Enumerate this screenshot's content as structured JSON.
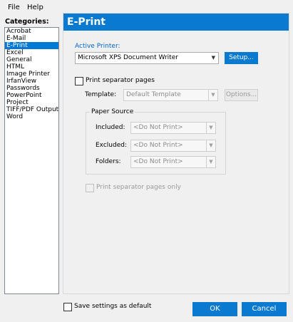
{
  "menu": {
    "file": "File",
    "help": "Help"
  },
  "categories": {
    "label": "Categories:",
    "items": [
      "Acrobat",
      "E-Mail",
      "E-Print",
      "Excel",
      "General",
      "HTML",
      "Image Printer",
      "IrfanView",
      "Passwords",
      "PowerPoint",
      "Project",
      "TIFF/PDF Output",
      "Word"
    ],
    "selected": "E-Print"
  },
  "panel": {
    "title": "E-Print",
    "active_printer_label": "Active Printer:",
    "active_printer_value": "Microsoft XPS Document Writer",
    "setup_button": "Setup...",
    "print_separator_label": "Print separator pages",
    "template_label": "Template:",
    "template_value": "Default Template",
    "options_button": "Options...",
    "paper_source": {
      "title": "Paper Source",
      "included_label": "Included:",
      "included_value": "<Do Not Print>",
      "excluded_label": "Excluded:",
      "excluded_value": "<Do Not Print>",
      "folders_label": "Folders:",
      "folders_value": "<Do Not Print>"
    },
    "separator_only_label": "Print separator pages only"
  },
  "footer": {
    "save_default_label": "Save settings as default",
    "ok": "OK",
    "cancel": "Cancel"
  },
  "colors": {
    "accent": "#0a7ad0",
    "selection": "#0078d7"
  }
}
